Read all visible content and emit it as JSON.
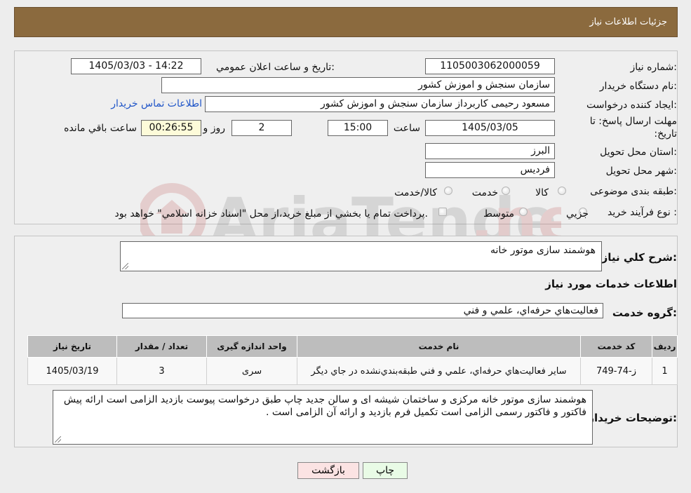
{
  "header": {
    "title": "جزئیات اطلاعات نیاز"
  },
  "form": {
    "need_number_label": "شماره نیاز:",
    "need_number": "1105003062000059",
    "announce_label": "تاریخ و ساعت اعلان عمومي:",
    "announce_value": "1405/03/03 - 14:22",
    "buyer_org_label": "نام دستگاه خريدار:",
    "buyer_org": "سازمان سنجش و اموزش کشور",
    "creator_label": "ايجاد کننده درخواست:",
    "creator": "مسعود رحیمی کاربرداز سازمان سنجش و اموزش کشور",
    "contact_link": "اطلاعات تماس خريدار",
    "deadline_label": "مهلت ارسال پاسخ: تا تاريخ:",
    "deadline_date": "1405/03/05",
    "time_label": "ساعت",
    "deadline_time": "15:00",
    "days_value": "2",
    "days_label": "روز و",
    "remaining_time": "00:26:55",
    "remaining_label": "ساعت باقي مانده",
    "province_label": "استان محل تحويل:",
    "province": "البرز",
    "city_label": "شهر محل تحويل:",
    "city": "فرديس",
    "category_label": "طبقه بندی موضوعی:",
    "category_options": [
      "کالا",
      "خدمت",
      "کالا/خدمت"
    ],
    "purchase_type_label": "نوع فرآيند خريد :",
    "purchase_options": [
      "جزيي",
      "متوسط"
    ],
    "purchase_note": "پرداخت تمام يا بخشي از مبلغ خريد،از محل \"اسناد خزانه اسلامي\" خواهد بود."
  },
  "details": {
    "summary_label": "شرح کلي نياز:",
    "summary": "هوشمند سازی موتور خانه",
    "services_heading": "اطلاعات خدمات مورد نياز",
    "service_group_label": "گروه خدمت:",
    "service_group": "فعاليت‌هاي حرفه‌اي، علمي و فني",
    "table": {
      "headers": [
        "رديف",
        "کد خدمت",
        "نام خدمت",
        "واحد اندازه گيری",
        "تعداد / مقدار",
        "تاريخ نياز"
      ],
      "rows": [
        [
          "1",
          "ز-74-749",
          "ساير فعاليت‌هاي حرفه‌اي، علمي و فني طبقه‌بندي‌نشده در جاي ديگر",
          "سری",
          "3",
          "1405/03/19"
        ]
      ]
    },
    "buyer_notes_label": "توضيحات خريدار:",
    "buyer_notes": "هوشمند سازی موتور خانه مرکزی و ساختمان شیشه ای و سالن جدید چاپ طبق درخواست پیوست بازدید الزامی است ارائه پیش فاکتور و فاکتور رسمی الزامی است تکمیل فرم بازدید و ارائه آن الزامی است ."
  },
  "buttons": {
    "print": "چاپ",
    "back": "بازگشت"
  },
  "colors": {
    "header_bg": "#8b6a3e",
    "back_btn_bg": "#fbe3e3",
    "print_btn_bg": "#e9fbe6",
    "link": "#1f55c8"
  }
}
